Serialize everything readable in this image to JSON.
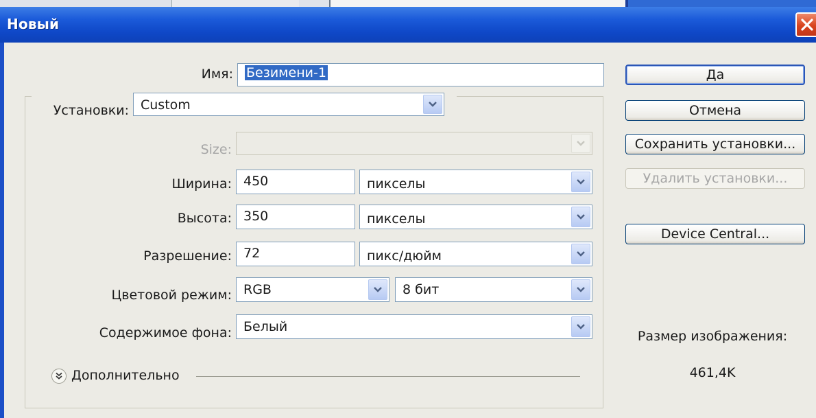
{
  "window": {
    "title": "Новый"
  },
  "name_field": {
    "label": "Имя:",
    "value": "Безимени-1"
  },
  "preset": {
    "label": "Установки:",
    "value": "Custom"
  },
  "size": {
    "label": "Size:",
    "value": ""
  },
  "width": {
    "label": "Ширина:",
    "value": "450",
    "unit": "пикселы"
  },
  "height": {
    "label": "Высота:",
    "value": "350",
    "unit": "пикселы"
  },
  "resolution": {
    "label": "Разрешение:",
    "value": "72",
    "unit": "пикс/дюйм"
  },
  "color_mode": {
    "label": "Цветовой режим:",
    "mode": "RGB",
    "depth": "8 бит"
  },
  "background": {
    "label": "Содержимое фона:",
    "value": "Белый"
  },
  "advanced": {
    "label": "Дополнительно"
  },
  "buttons": {
    "ok": "Да",
    "cancel": "Отмена",
    "save_preset": "Сохранить установки...",
    "delete_preset": "Удалить установки...",
    "device_central": "Device Central..."
  },
  "image_size": {
    "label": "Размер изображения:",
    "value": "461,4K"
  },
  "colors": {
    "titlebar": "#1b5ad9",
    "dialog_bg": "#ecebe5",
    "selection": "#316ac5",
    "close": "#d8441e"
  }
}
